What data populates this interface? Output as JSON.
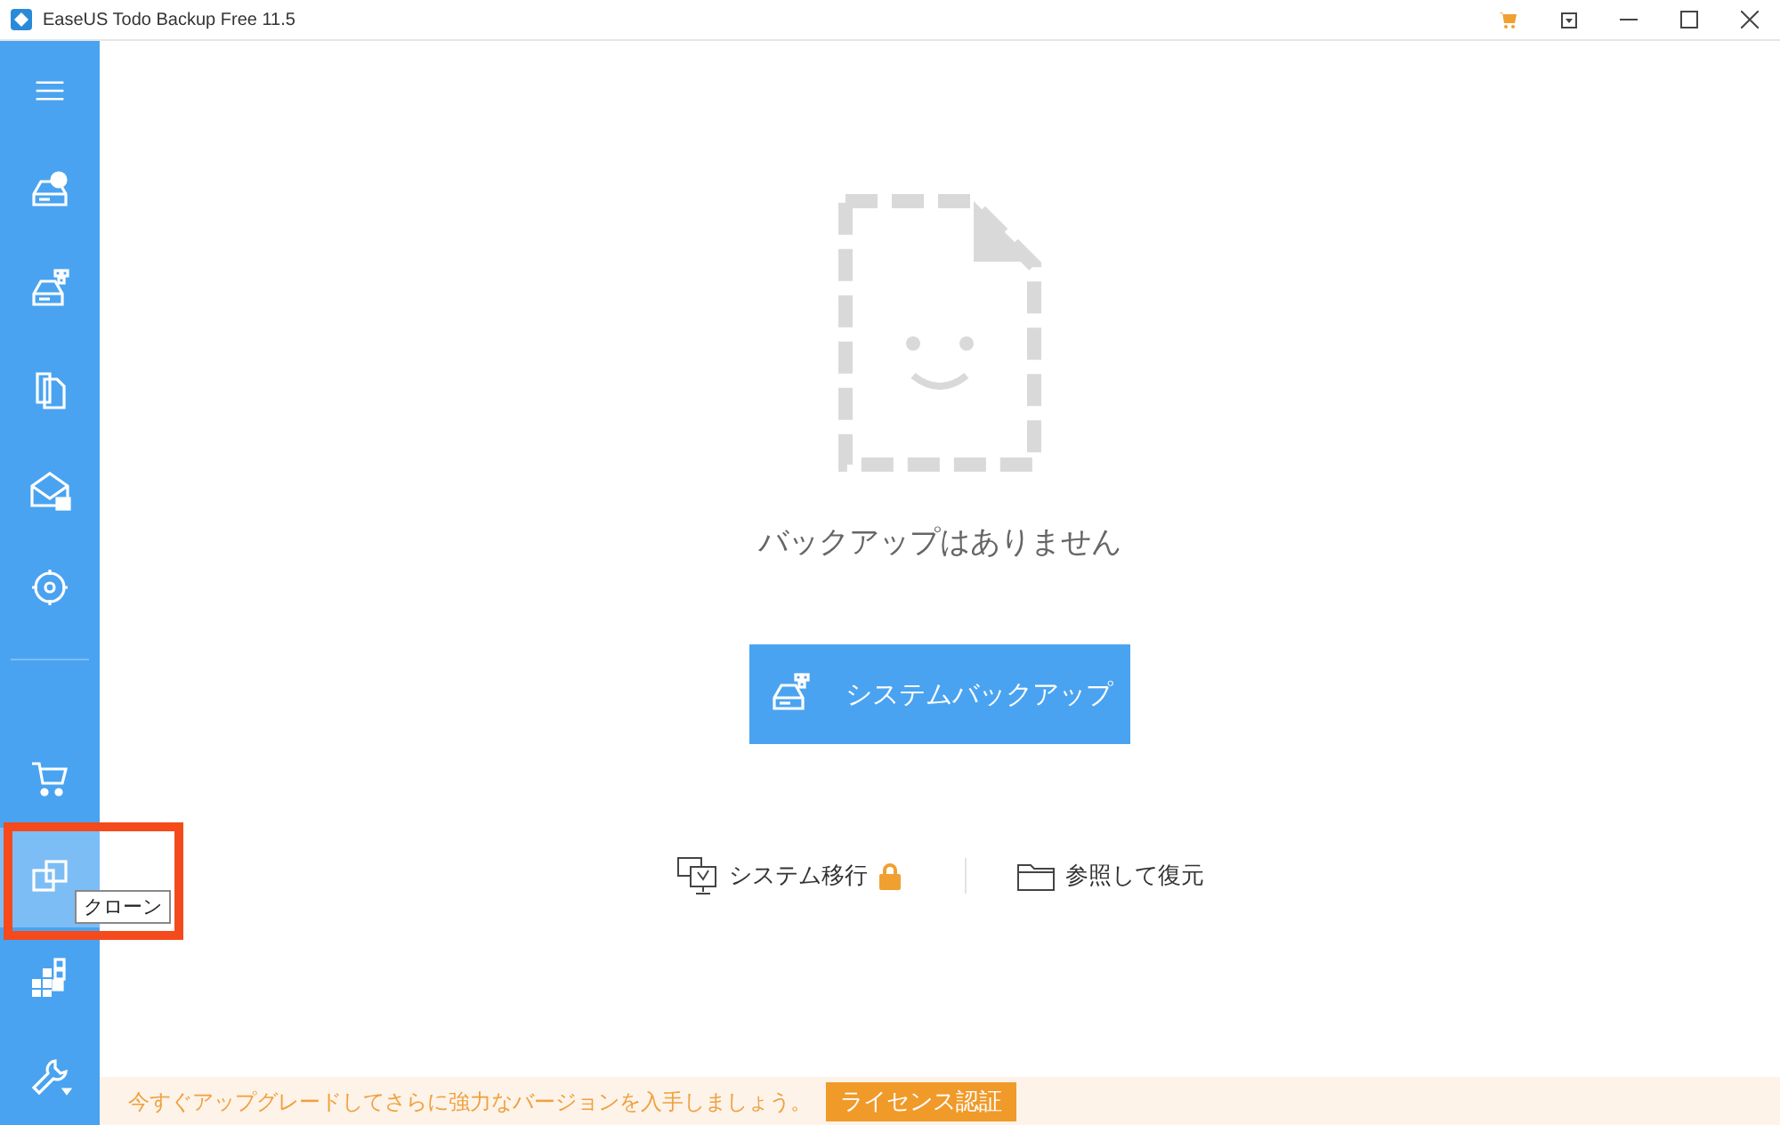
{
  "window": {
    "title": "EaseUS Todo Backup Free 11.5"
  },
  "sidebar": {
    "top_items": [
      {
        "kind": "menu",
        "hovered": false
      },
      {
        "kind": "disk",
        "hovered": false
      },
      {
        "kind": "disk-files",
        "hovered": false
      },
      {
        "kind": "files",
        "hovered": false
      },
      {
        "kind": "mail",
        "hovered": false
      },
      {
        "kind": "target",
        "hovered": false
      }
    ],
    "bottom_items": [
      {
        "kind": "cart",
        "hovered": false
      },
      {
        "kind": "clone",
        "hovered": true
      },
      {
        "kind": "tiles",
        "hovered": false
      },
      {
        "kind": "wrench",
        "hovered": false
      }
    ],
    "tooltip": "クローン"
  },
  "empty_state": {
    "message": "バックアップはありません"
  },
  "primary_button": {
    "label": "システムバックアップ"
  },
  "links": [
    {
      "kind": "migrate",
      "label": "システム移行",
      "locked": true
    },
    {
      "kind": "restore",
      "label": "参照して復元",
      "locked": false
    }
  ],
  "upgrade_bar": {
    "message": "今すぐアップグレードしてさらに強力なバージョンを入手しましょう。",
    "button": "ライセンス認証"
  }
}
